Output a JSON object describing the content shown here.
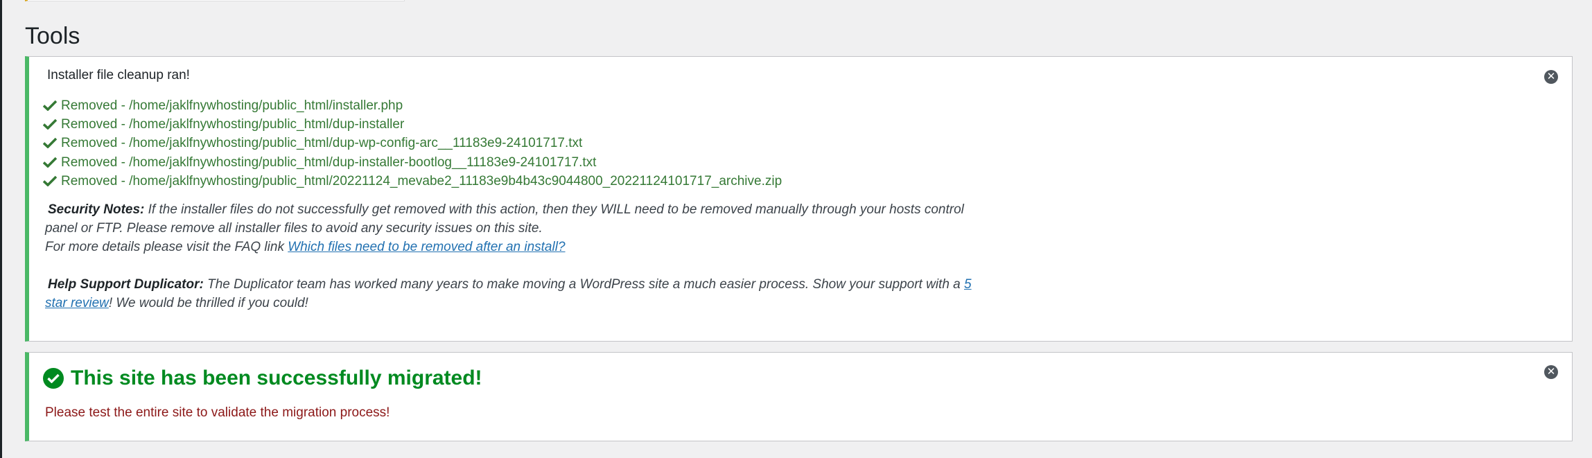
{
  "page": {
    "title": "Tools"
  },
  "cleanup_notice": {
    "title": "Installer file cleanup ran!",
    "removed_files": [
      "Removed - /home/jaklfnywhosting/public_html/installer.php",
      "Removed - /home/jaklfnywhosting/public_html/dup-installer",
      "Removed - /home/jaklfnywhosting/public_html/dup-wp-config-arc__11183e9-24101717.txt",
      "Removed - /home/jaklfnywhosting/public_html/dup-installer-bootlog__11183e9-24101717.txt",
      "Removed - /home/jaklfnywhosting/public_html/20221124_mevabe2_11183e9b4b43c9044800_20221124101717_archive.zip"
    ],
    "security": {
      "label": "Security Notes:",
      "text": " If the installer files do not successfully get removed with this action, then they WILL need to be removed manually through your hosts control panel or FTP. Please remove all installer files to avoid any security issues on this site.",
      "faq_prefix": "For more details please visit the FAQ link ",
      "faq_link": "Which files need to be removed after an install?"
    },
    "help": {
      "label": "Help Support Duplicator:",
      "text": " The Duplicator team has worked many years to make moving a WordPress site a much easier process. Show your support with a ",
      "review_link": "5 star review",
      "suffix": "! We would be thrilled if you could!"
    },
    "dismiss_icon": "close-circle-icon",
    "accent_color": "#4ab866"
  },
  "migration_notice": {
    "title": "This site has been successfully migrated!",
    "subtitle": "Please test the entire site to validate the migration process!",
    "icon": "check-circle-icon",
    "title_color": "#008a20",
    "subtitle_color": "#8c1818",
    "dismiss_icon": "close-circle-icon"
  }
}
